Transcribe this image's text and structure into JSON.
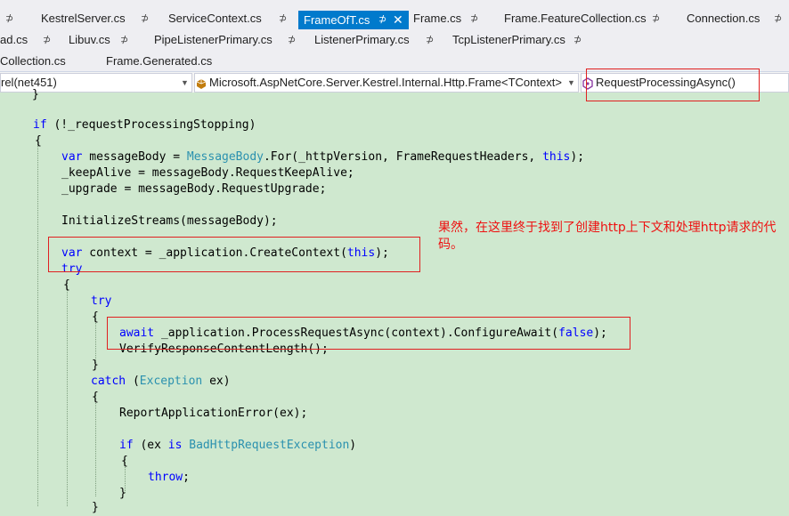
{
  "tabs": {
    "row1": [
      {
        "label": "KestrelServer.cs",
        "pin": "⊅"
      },
      {
        "label": "ServiceContext.cs",
        "pin": "⊅"
      },
      {
        "label": "FrameOfT.cs",
        "pin": "⊅",
        "close": "✕",
        "active": true
      },
      {
        "label": "Frame.cs",
        "pin": "⊅"
      },
      {
        "label": "Frame.FeatureCollection.cs",
        "pin": "⊅"
      },
      {
        "label": "Connection.cs",
        "pin": "⊅"
      }
    ],
    "row1_lead_pin": "⊅",
    "row2": [
      {
        "label": "ad.cs",
        "pin": "⊅"
      },
      {
        "label": "Libuv.cs",
        "pin": "⊅"
      },
      {
        "label": "PipeListenerPrimary.cs",
        "pin": "⊅"
      },
      {
        "label": "ListenerPrimary.cs",
        "pin": "⊅"
      },
      {
        "label": "TcpListenerPrimary.cs",
        "pin": "⊅"
      }
    ],
    "row3": [
      {
        "label": "Collection.cs"
      },
      {
        "label": "Frame.Generated.cs"
      }
    ]
  },
  "navbar": {
    "project": "rel(net451)",
    "type": "Microsoft.AspNetCore.Server.Kestrel.Internal.Http.Frame<TContext>",
    "member": "RequestProcessingAsync()"
  },
  "code": {
    "l0": "}",
    "l1_if": "if",
    "l1_rest": " (!_requestProcessingStopping)",
    "l2": "{",
    "l3_var": "var",
    "l3_a": " messageBody = ",
    "l3_type": "MessageBody",
    "l3_b": ".For(_httpVersion, FrameRequestHeaders, ",
    "l3_this": "this",
    "l3_c": ");",
    "l4": "_keepAlive = messageBody.RequestKeepAlive;",
    "l5": "_upgrade = messageBody.RequestUpgrade;",
    "l6": "InitializeStreams(messageBody);",
    "l7_var": "var",
    "l7_a": " context = _application.CreateContext(",
    "l7_this": "this",
    "l7_b": ");",
    "l8_try": "try",
    "l9": "{",
    "l10_try": "try",
    "l11": "{",
    "l12_await": "await",
    "l12_a": " _application.ProcessRequestAsync(context).ConfigureAwait(",
    "l12_false": "false",
    "l12_b": ");",
    "l13": "VerifyResponseContentLength();",
    "l14": "}",
    "l15_catch": "catch",
    "l15_a": " (",
    "l15_type": "Exception",
    "l15_b": " ex)",
    "l16": "{",
    "l17": "ReportApplicationError(ex);",
    "l18_if": "if",
    "l18_a": " (ex ",
    "l18_is": "is",
    "l18_type": "BadHttpRequestException",
    "l18_b": ")",
    "l19": "{",
    "l20_throw": "throw",
    "l20_a": ";",
    "l21": "}",
    "l22": "}"
  },
  "annotation": "果然，在这里终于找到了创建http上下文和处理http请求的代码。",
  "colors": {
    "editor_bg": "#cfe8cf",
    "keyword": "#0000ff",
    "type": "#2b91af",
    "annotation": "#ee1111",
    "active_tab": "#007acc",
    "highlight_box": "#e02020"
  }
}
